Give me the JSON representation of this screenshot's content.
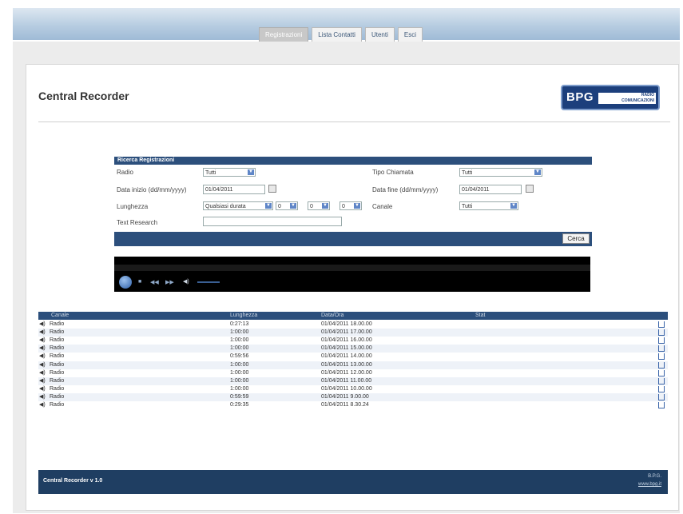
{
  "nav": {
    "tabs": [
      {
        "label": "Registrazioni",
        "active": true
      },
      {
        "label": "Lista Contatti",
        "active": false
      },
      {
        "label": "Utenti",
        "active": false
      },
      {
        "label": "Esci",
        "active": false
      }
    ]
  },
  "header": {
    "title": "Central Recorder",
    "logo_main": "BPG",
    "logo_sub_line1": "RADIO",
    "logo_sub_line2": "COMUNICAZIONI"
  },
  "search": {
    "title": "Ricerca Registrazioni",
    "radio_label": "Radio",
    "radio_value": "Tutti",
    "tipo_label": "Tipo Chiamata",
    "tipo_value": "Tutti",
    "data_inizio_label": "Data inizio (dd/mm/yyyy)",
    "data_inizio_value": "01/04/2011",
    "data_fine_label": "Data fine (dd/mm/yyyy)",
    "data_fine_value": "01/04/2011",
    "lunghezza_label": "Lunghezza",
    "lunghezza_value": "Qualsiasi durata",
    "lunghezza_h": "0",
    "lunghezza_m": "0",
    "lunghezza_s": "0",
    "canale_label": "Canale",
    "canale_value": "Tutti",
    "text_label": "Text Research",
    "text_value": "",
    "button": "Cerca"
  },
  "table": {
    "headers": [
      "Canale",
      "Lunghezza",
      "Data/Ora",
      "Stat"
    ],
    "rows": [
      {
        "canale": "Radio",
        "lunghezza": "0:27:13",
        "data": "01/04/2011 18.00.00"
      },
      {
        "canale": "Radio",
        "lunghezza": "1:00:00",
        "data": "01/04/2011 17.00.00"
      },
      {
        "canale": "Radio",
        "lunghezza": "1:00:00",
        "data": "01/04/2011 16.00.00"
      },
      {
        "canale": "Radio",
        "lunghezza": "1:00:00",
        "data": "01/04/2011 15.00.00"
      },
      {
        "canale": "Radio",
        "lunghezza": "0:59:56",
        "data": "01/04/2011 14.00.00"
      },
      {
        "canale": "Radio",
        "lunghezza": "1:00:00",
        "data": "01/04/2011 13.00.00"
      },
      {
        "canale": "Radio",
        "lunghezza": "1:00:00",
        "data": "01/04/2011 12.00.00"
      },
      {
        "canale": "Radio",
        "lunghezza": "1:00:00",
        "data": "01/04/2011 11.00.00"
      },
      {
        "canale": "Radio",
        "lunghezza": "1:00:00",
        "data": "01/04/2011 10.00.00"
      },
      {
        "canale": "Radio",
        "lunghezza": "0:59:59",
        "data": "01/04/2011 9.00.00"
      },
      {
        "canale": "Radio",
        "lunghezza": "0:29:35",
        "data": "01/04/2011 8.30.24"
      }
    ]
  },
  "footer": {
    "version": "Central Recorder v 1.0",
    "brand": "B.P.G.",
    "link": "www.bpg.it"
  },
  "colors": {
    "accent": "#2c4f7c",
    "footer": "#1f3e62",
    "topbar": "#b7cde1"
  }
}
